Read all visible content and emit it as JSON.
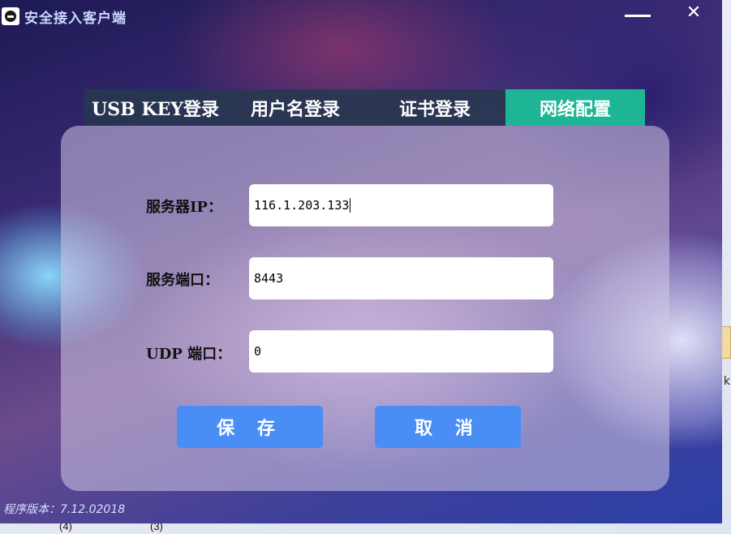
{
  "window": {
    "title": "安全接入客户端",
    "minimize_icon": "minimize-icon",
    "close_glyph": "✕"
  },
  "tabs": [
    {
      "label": "USB KEY登录",
      "active": false
    },
    {
      "label": "用户名登录",
      "active": false
    },
    {
      "label": "证书登录",
      "active": false
    },
    {
      "label": "网络配置",
      "active": true
    }
  ],
  "form": {
    "server_ip": {
      "label": "服务器IP：",
      "value": "116.1.203.133"
    },
    "server_port": {
      "label": "服务端口：",
      "value": "8443"
    },
    "udp_port": {
      "label": "UDP 端口：",
      "value": "0"
    }
  },
  "buttons": {
    "save": "保 存",
    "cancel": "取 消"
  },
  "version_text": "程序版本：7.12.02018",
  "desktop": {
    "label_4": "(4)",
    "label_3": "(3)",
    "edge_char": "k"
  },
  "colors": {
    "active_tab": "#1db596",
    "tab_bar": "#283750",
    "button": "#4a8df5"
  }
}
